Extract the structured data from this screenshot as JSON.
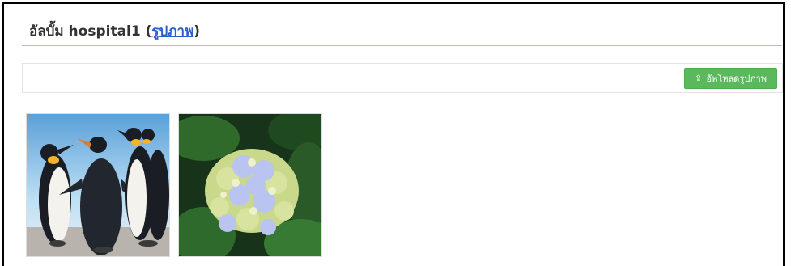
{
  "album": {
    "prefix": "อัลบั้ม hospital1 (",
    "link_label": "รูปภาพ",
    "suffix": ")"
  },
  "toolbar": {
    "upload_label": "อัพโหลดรูปภาพ",
    "upload_icon": "upload-icon"
  },
  "photos": [
    {
      "subject": "penguins"
    },
    {
      "subject": "hydrangea"
    }
  ],
  "colors": {
    "accent_rule": "#f0a8b0",
    "upload_button": "#5cb85c",
    "link": "#2a62c9"
  }
}
